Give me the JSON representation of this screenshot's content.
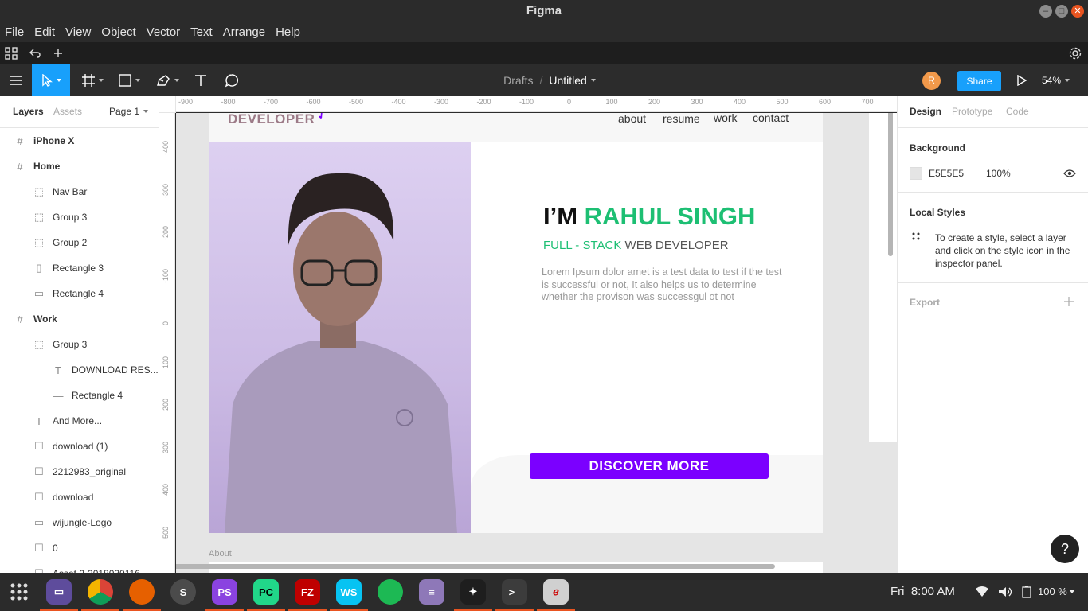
{
  "window": {
    "title": "Figma"
  },
  "menubar": {
    "items": [
      "File",
      "Edit",
      "View",
      "Object",
      "Vector",
      "Text",
      "Arrange",
      "Help"
    ]
  },
  "toolbar": {
    "breadcrumb_parent": "Drafts",
    "breadcrumb_sep": "/",
    "file_name": "Untitled",
    "avatar_initial": "R",
    "share_label": "Share",
    "zoom": "54%"
  },
  "left_panel": {
    "tabs": [
      "Layers",
      "Assets"
    ],
    "page": "Page 1",
    "layers": [
      {
        "name": "iPhone X",
        "icon": "#"
      },
      {
        "name": "Home",
        "icon": "#"
      },
      {
        "name": "Nav Bar",
        "icon": "⬚"
      },
      {
        "name": "Group 3",
        "icon": "⬚"
      },
      {
        "name": "Group 2",
        "icon": "⬚"
      },
      {
        "name": "Rectangle 3",
        "icon": "▯"
      },
      {
        "name": "Rectangle 4",
        "icon": "▭"
      },
      {
        "name": "Work",
        "icon": "#"
      },
      {
        "name": "Group 3",
        "icon": "⬚"
      },
      {
        "name": "DOWNLOAD RES...",
        "icon": "T"
      },
      {
        "name": "Rectangle 4",
        "icon": "—"
      },
      {
        "name": "And More...",
        "icon": "T"
      },
      {
        "name": "download (1)",
        "icon": "☐"
      },
      {
        "name": "2212983_original",
        "icon": "☐"
      },
      {
        "name": "download",
        "icon": "☐"
      },
      {
        "name": "wijungle-Logo",
        "icon": "▭"
      },
      {
        "name": "0",
        "icon": "☐"
      },
      {
        "name": "Asset 2-2018030116...",
        "icon": "☐"
      }
    ]
  },
  "rulers": {
    "top": [
      "-900",
      "-800",
      "-700",
      "-600",
      "-500",
      "-400",
      "-300",
      "-200",
      "-100",
      "0",
      "100",
      "200",
      "300",
      "400",
      "500",
      "600",
      "700"
    ],
    "left": [
      "-400",
      "-300",
      "-200",
      "-100",
      "0",
      "100",
      "200",
      "300",
      "400",
      "500"
    ]
  },
  "design": {
    "logo_text": "DEVELOPER",
    "nav": [
      "about",
      "resume",
      "work",
      "contact"
    ],
    "headline_prefix": "I’M ",
    "headline_name": "RAHUL SINGH",
    "subtitle_accent": "FULL - STACK ",
    "subtitle_rest": "WEB DEVELOPER",
    "body": "Lorem Ipsum dolor amet is a test data to test if the test is successful or not, It also helps us to determine whether the provison was successgul ot not",
    "cta": "DISCOVER MORE",
    "next_frame_label": "About",
    "colors": {
      "accent_green": "#1dbf73",
      "cta_purple": "#7b00ff",
      "photo_tint": "#cdb8ee"
    }
  },
  "right_panel": {
    "tabs": [
      "Design",
      "Prototype",
      "Code"
    ],
    "background_title": "Background",
    "background_hex": "E5E5E5",
    "background_opacity": "100%",
    "local_styles_title": "Local Styles",
    "local_styles_hint": "To create a style, select a layer and click on the style icon in the inspector panel.",
    "export_title": "Export",
    "help": "?"
  },
  "taskbar": {
    "clock": "Fri  8:00 AM",
    "battery": "100 %",
    "apps": [
      "files",
      "chrome",
      "firefox",
      "sublime",
      "phpstorm",
      "pycharm",
      "filezilla",
      "webstorm",
      "spotify",
      "text-editor",
      "figma",
      "terminal",
      "draw"
    ]
  }
}
